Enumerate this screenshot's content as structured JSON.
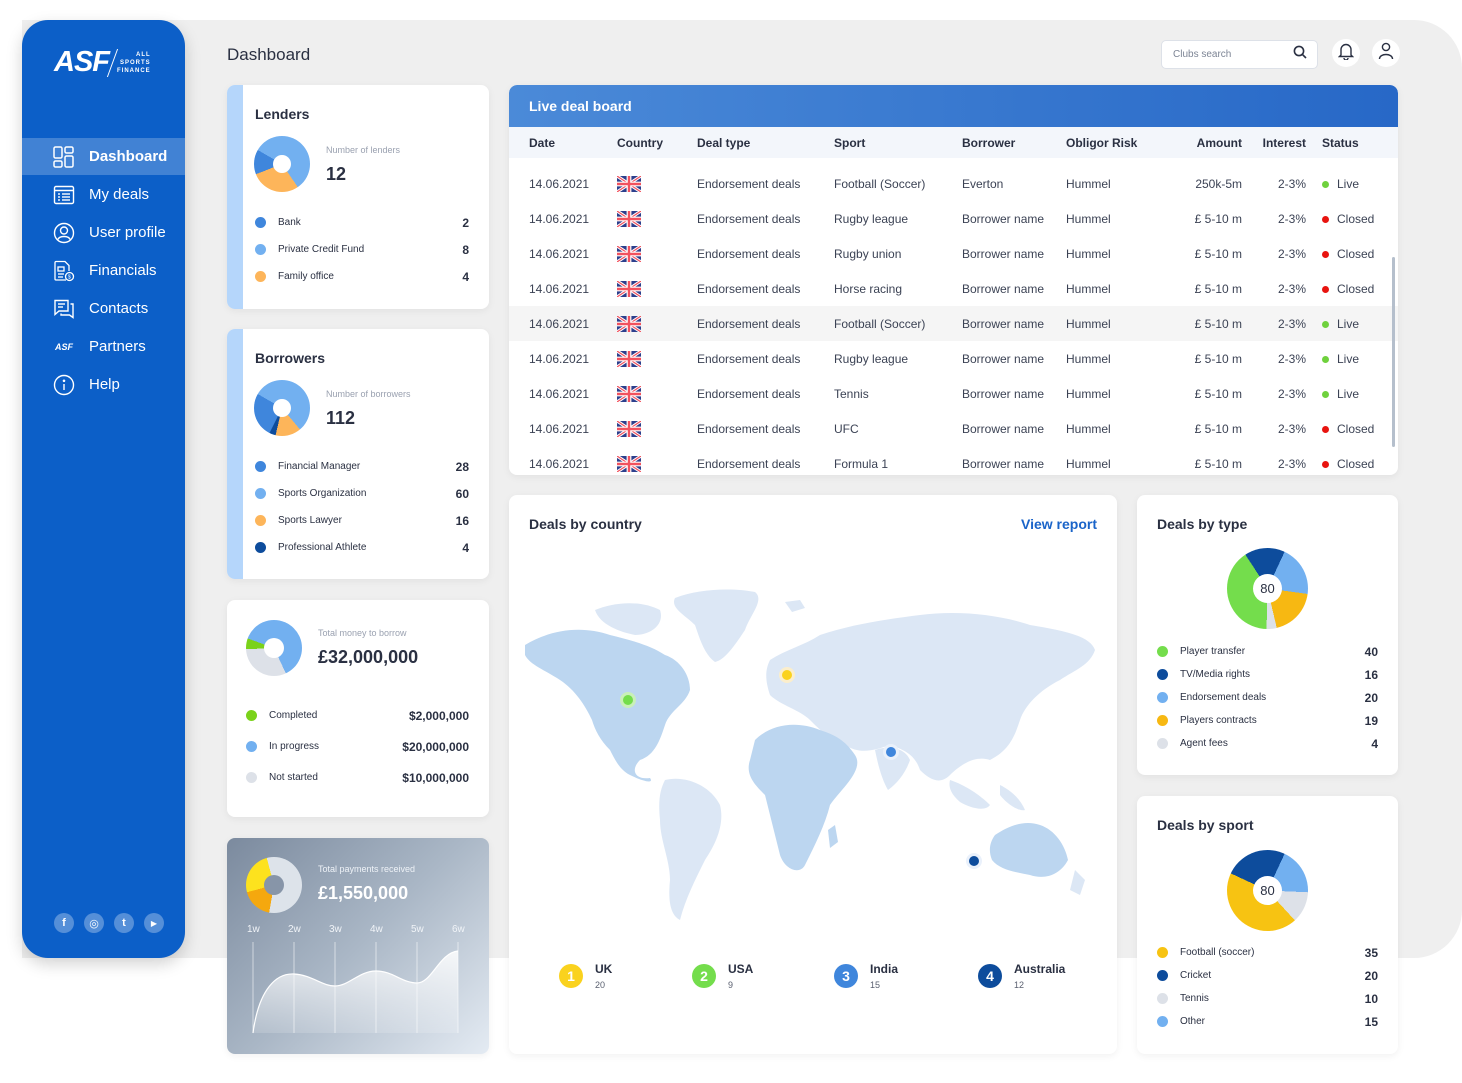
{
  "brand": {
    "logo": "ASF",
    "sub_lines": [
      "ALL",
      "SPORTS",
      "FINANCE"
    ],
    "mini_logo": "ASF"
  },
  "sidebar": {
    "items": [
      {
        "label": "Dashboard",
        "icon": "dashboard-icon",
        "active": true
      },
      {
        "label": "My deals",
        "icon": "deals-list-icon",
        "active": false
      },
      {
        "label": "User profile",
        "icon": "user-profile-icon",
        "active": false
      },
      {
        "label": "Financials",
        "icon": "financials-icon",
        "active": false
      },
      {
        "label": "Contacts",
        "icon": "contacts-chat-icon",
        "active": false
      },
      {
        "label": "Partners",
        "icon": "asf-logo-icon",
        "active": false
      },
      {
        "label": "Help",
        "icon": "info-icon",
        "active": false
      }
    ],
    "socials": [
      {
        "name": "facebook",
        "glyph": "f"
      },
      {
        "name": "instagram",
        "glyph": "◎"
      },
      {
        "name": "twitter",
        "glyph": "t"
      },
      {
        "name": "youtube",
        "glyph": "▶"
      }
    ]
  },
  "header": {
    "title": "Dashboard",
    "search_placeholder": "Clubs search",
    "search_value": ""
  },
  "lenders": {
    "title": "Lenders",
    "kpi_label": "Number of lenders",
    "kpi_value": "12",
    "items": [
      {
        "label": "Bank",
        "value": "2",
        "color": "#3f86dc"
      },
      {
        "label": "Private Credit Fund",
        "value": "8",
        "color": "#72b0f0"
      },
      {
        "label": "Family office",
        "value": "4",
        "color": "#fdb55a"
      }
    ]
  },
  "borrowers": {
    "title": "Borrowers",
    "kpi_label": "Number of borrowers",
    "kpi_value": "112",
    "items": [
      {
        "label": "Financial Manager",
        "value": "28",
        "color": "#3f86dc"
      },
      {
        "label": "Sports Organization",
        "value": "60",
        "color": "#72b0f0"
      },
      {
        "label": "Sports Lawyer",
        "value": "16",
        "color": "#fdb55a"
      },
      {
        "label": "Professional Athlete",
        "value": "4",
        "color": "#0d4c9c"
      }
    ]
  },
  "money": {
    "kpi_label": "Total money to borrow",
    "kpi_value": "£32,000,000",
    "items": [
      {
        "label": "Completed",
        "value": "$2,000,000",
        "color": "#7ad21a"
      },
      {
        "label": "In progress",
        "value": "$20,000,000",
        "color": "#72b0f0"
      },
      {
        "label": "Not started",
        "value": "$10,000,000",
        "color": "#dde1e8"
      }
    ]
  },
  "payments": {
    "kpi_label": "Total payments received",
    "kpi_value": "£1,550,000",
    "weeks": [
      "1w",
      "2w",
      "3w",
      "4w",
      "5w",
      "6w"
    ]
  },
  "deal_board": {
    "title": "Live deal board",
    "columns": [
      "Date",
      "Country",
      "Deal type",
      "Sport",
      "Borrower",
      "Obligor Risk",
      "Amount",
      "Interest",
      "Status"
    ],
    "rows": [
      {
        "date": "14.06.2021",
        "country": "UK",
        "deal_type": "Endorsement deals",
        "sport": "Football (Soccer)",
        "borrower": "Everton",
        "risk": "Hummel",
        "amount": "250k-5m",
        "interest": "2-3%",
        "status": "Live"
      },
      {
        "date": "14.06.2021",
        "country": "UK",
        "deal_type": "Endorsement deals",
        "sport": "Rugby league",
        "borrower": "Borrower name",
        "risk": "Hummel",
        "amount": "£ 5-10 m",
        "interest": "2-3%",
        "status": "Closed"
      },
      {
        "date": "14.06.2021",
        "country": "UK",
        "deal_type": "Endorsement deals",
        "sport": "Rugby union",
        "borrower": "Borrower name",
        "risk": "Hummel",
        "amount": "£ 5-10 m",
        "interest": "2-3%",
        "status": "Closed"
      },
      {
        "date": "14.06.2021",
        "country": "UK",
        "deal_type": "Endorsement deals",
        "sport": "Horse racing",
        "borrower": "Borrower name",
        "risk": "Hummel",
        "amount": "£ 5-10 m",
        "interest": "2-3%",
        "status": "Closed"
      },
      {
        "date": "14.06.2021",
        "country": "UK",
        "deal_type": "Endorsement deals",
        "sport": "Football (Soccer)",
        "borrower": "Borrower name",
        "risk": "Hummel",
        "amount": "£ 5-10 m",
        "interest": "2-3%",
        "status": "Live"
      },
      {
        "date": "14.06.2021",
        "country": "UK",
        "deal_type": "Endorsement deals",
        "sport": "Rugby league",
        "borrower": "Borrower name",
        "risk": "Hummel",
        "amount": "£ 5-10 m",
        "interest": "2-3%",
        "status": "Live"
      },
      {
        "date": "14.06.2021",
        "country": "UK",
        "deal_type": "Endorsement deals",
        "sport": "Tennis",
        "borrower": "Borrower name",
        "risk": "Hummel",
        "amount": "£ 5-10 m",
        "interest": "2-3%",
        "status": "Live"
      },
      {
        "date": "14.06.2021",
        "country": "UK",
        "deal_type": "Endorsement deals",
        "sport": "UFC",
        "borrower": "Borrower name",
        "risk": "Hummel",
        "amount": "£ 5-10 m",
        "interest": "2-3%",
        "status": "Closed"
      },
      {
        "date": "14.06.2021",
        "country": "UK",
        "deal_type": "Endorsement deals",
        "sport": "Formula 1",
        "borrower": "Borrower name",
        "risk": "Hummel",
        "amount": "£ 5-10 m",
        "interest": "2-3%",
        "status": "Closed"
      }
    ],
    "status_colors": {
      "Live": "#6fd13d",
      "Closed": "#e8140f"
    }
  },
  "deals_by_country": {
    "title": "Deals by country",
    "link": "View report",
    "countries": [
      {
        "rank": "1",
        "name": "UK",
        "count": "20",
        "color": "#fad21e"
      },
      {
        "rank": "2",
        "name": "USA",
        "count": "9",
        "color": "#74dd4c"
      },
      {
        "rank": "3",
        "name": "India",
        "count": "15",
        "color": "#3f86dc"
      },
      {
        "rank": "4",
        "name": "Australia",
        "count": "12",
        "color": "#0d4c9c"
      }
    ]
  },
  "deals_by_type": {
    "title": "Deals by type",
    "center": "80",
    "items": [
      {
        "label": "Player transfer",
        "value": "40",
        "color": "#74dd4c"
      },
      {
        "label": "TV/Media rights",
        "value": "16",
        "color": "#0d4c9c"
      },
      {
        "label": "Endorsement deals",
        "value": "20",
        "color": "#72b0f0"
      },
      {
        "label": "Players contracts",
        "value": "19",
        "color": "#f7b812"
      },
      {
        "label": "Agent fees",
        "value": "4",
        "color": "#dde1e8"
      }
    ]
  },
  "deals_by_sport": {
    "title": "Deals by sport",
    "center": "80",
    "items": [
      {
        "label": "Football (soccer)",
        "value": "35",
        "color": "#f7c312"
      },
      {
        "label": "Cricket",
        "value": "20",
        "color": "#0d4c9c"
      },
      {
        "label": "Tennis",
        "value": "10",
        "color": "#dde1e8"
      },
      {
        "label": "Other",
        "value": "15",
        "color": "#72b0f0"
      }
    ]
  }
}
